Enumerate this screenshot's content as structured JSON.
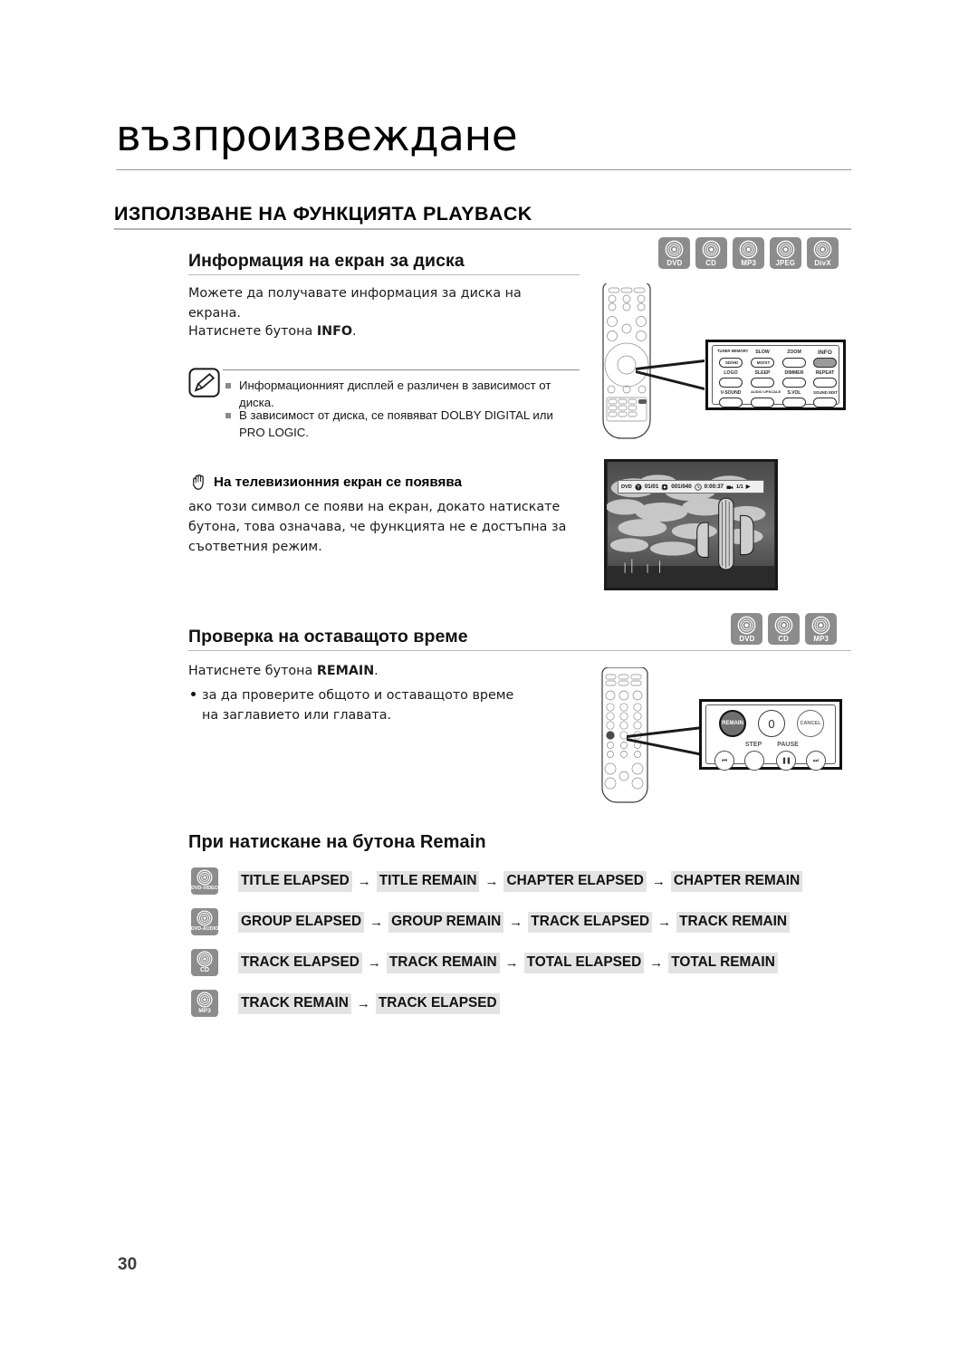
{
  "document": {
    "chapter_title": "възпроизвеждане",
    "section_heading": "ИЗПОЛЗВАНЕ НА ФУНКЦИЯТА PLAYBACK",
    "page_number": "30"
  },
  "section1": {
    "heading": "Информация на екран за диска",
    "paragraph1": "Можете да получавате информация за диска на екрана.",
    "paragraph2_prefix": "Натиснете бутона ",
    "paragraph2_bold": "INFO",
    "paragraph2_suffix": ".",
    "disc_icons": [
      {
        "label": "DVD"
      },
      {
        "label": "CD"
      },
      {
        "label": "MP3"
      },
      {
        "label": "JPEG"
      },
      {
        "label": "DivX"
      }
    ],
    "notes": [
      "Информационният дисплей е различен в зависимост от диска.",
      "В зависимост от диска, се появяват DOLBY DIGITAL или PRO LOGIC."
    ],
    "caution": {
      "title": "На телевизионния екран се появява",
      "body": "ако този символ се появи на екран, докато натискате бутона, това означава, че функцията не е достъпна за съответния режим."
    }
  },
  "section2": {
    "heading": "Проверка на оставащото време",
    "paragraph_prefix": "Натиснете бутона ",
    "paragraph_bold": "REMAIN",
    "paragraph_suffix": ".",
    "bullet": "за да проверите общото и оставащото време на заглавието или главата.",
    "disc_icons": [
      {
        "label": "DVD"
      },
      {
        "label": "CD"
      },
      {
        "label": "MP3"
      }
    ]
  },
  "section3": {
    "heading": "При натискане на бутона Remain",
    "rows": [
      {
        "disc": "DVD-VIDEO",
        "items": [
          "TITLE ELAPSED",
          "TITLE REMAIN",
          "CHAPTER ELAPSED",
          "CHAPTER REMAIN"
        ]
      },
      {
        "disc": "DVD-AUDIO",
        "items": [
          "GROUP ELAPSED",
          "GROUP REMAIN",
          "TRACK ELAPSED",
          "TRACK REMAIN"
        ]
      },
      {
        "disc": "CD",
        "items": [
          "TRACK ELAPSED",
          "TRACK REMAIN",
          "TOTAL ELAPSED",
          "TOTAL REMAIN"
        ]
      },
      {
        "disc": "MP3",
        "items": [
          "TRACK REMAIN",
          "TRACK ELAPSED"
        ]
      }
    ],
    "arrow": "→"
  },
  "remote_info_callout": {
    "buttons": [
      {
        "top_label": "TUNER MEMORY",
        "key_label": "SD/HD"
      },
      {
        "top_label": "SLOW",
        "key_label": "MO/ST"
      },
      {
        "top_label": "ZOOM",
        "key_label": ""
      },
      {
        "top_label": "INFO",
        "key_label": "",
        "highlighted": true
      },
      {
        "top_label": "LOGO",
        "key_label": ""
      },
      {
        "top_label": "SLEEP",
        "key_label": ""
      },
      {
        "top_label": "DIMMER",
        "key_label": ""
      },
      {
        "top_label": "REPEAT",
        "key_label": ""
      },
      {
        "top_label": "V-SOUND",
        "key_label": ""
      },
      {
        "top_label": "AUDIO UPSCALE",
        "key_label": ""
      },
      {
        "top_label": "S.VOL",
        "key_label": ""
      },
      {
        "top_label": "SOUND EDIT",
        "key_label": ""
      }
    ]
  },
  "remote_remain_callout": {
    "remain_label": "REMAIN",
    "zero_label": "0",
    "cancel_label": "CANCEL",
    "step_label": "STEP",
    "pause_label": "PAUSE",
    "prev_icon": "⏮",
    "pause_icon": "❚❚",
    "next_icon": "⏭"
  },
  "tv_osd": {
    "disc_type": "DVD",
    "title": "01/01",
    "chapter": "001/040",
    "time": "0:00:37",
    "angle": "1/1",
    "play_icon": "▶"
  }
}
